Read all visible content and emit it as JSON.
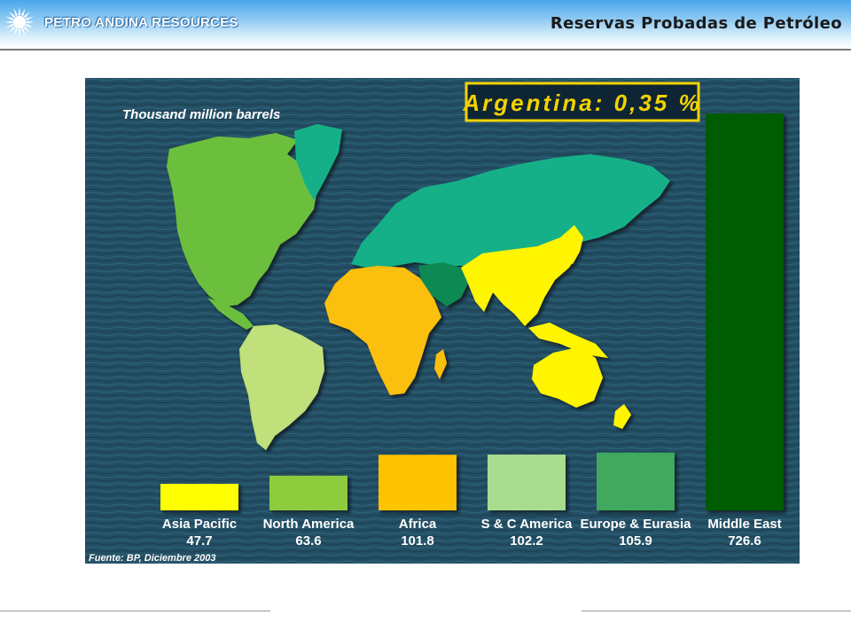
{
  "header": {
    "company": "PETRO ANDINA RESOURCES",
    "title": "Reservas Probadas de Petróleo"
  },
  "chart_data": {
    "type": "bar",
    "title": "Argentina: 0,35 %",
    "ylabel": "Thousand million barrels",
    "source": "Fuente: BP, Diciembre 2003",
    "categories": [
      "Asia Pacific",
      "North America",
      "Africa",
      "S & C America",
      "Europe & Eurasia",
      "Middle East"
    ],
    "values": [
      47.7,
      63.6,
      101.8,
      102.2,
      105.9,
      726.6
    ],
    "value_labels": [
      "47.7",
      "63.6",
      "101.8",
      "102.2",
      "105.9",
      "726.6"
    ],
    "colors": [
      "#ffff00",
      "#8dcc3c",
      "#fdc300",
      "#a8dc8e",
      "#3fa85e",
      "#025c02"
    ],
    "map_regions": {
      "north_america": "#6cbf3c",
      "south_america": "#bfe07a",
      "africa": "#fbbf0a",
      "europe_eurasia": "#16b088",
      "middle_east": "#0f8a52",
      "asia_pacific": "#fff500"
    },
    "background_color": "#234e63",
    "grid": false
  }
}
